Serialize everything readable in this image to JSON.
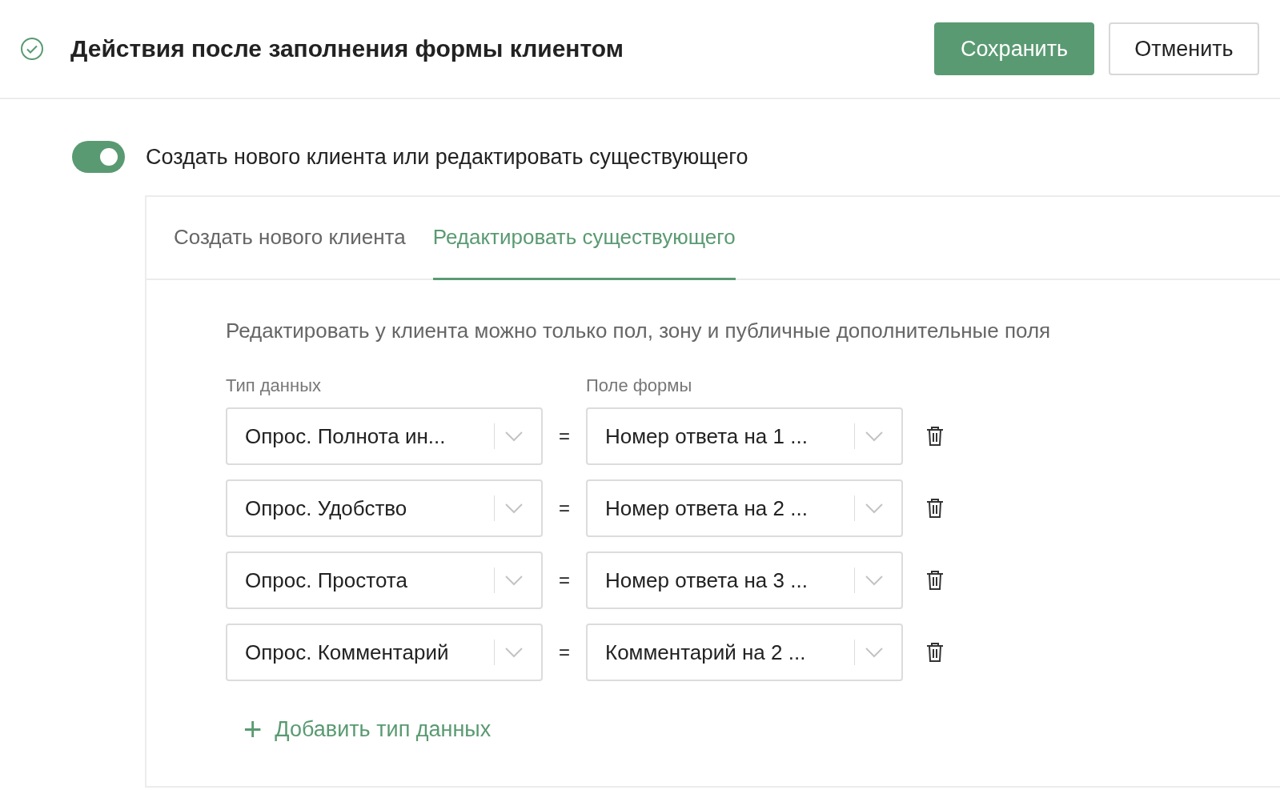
{
  "header": {
    "title": "Действия после заполнения формы клиентом",
    "buttons": [
      {
        "label": "Сохранить",
        "kind": "primary"
      },
      {
        "label": "Отменить",
        "kind": "secondary"
      }
    ]
  },
  "toggle": {
    "label": "Создать нового клиента или редактировать существующего",
    "on": true
  },
  "tabs": [
    {
      "label": "Создать нового клиента",
      "selected": false
    },
    {
      "label": "Редактировать существующего",
      "selected": true
    }
  ],
  "description": "Редактировать у клиента можно только пол, зону и публичные дополнительные поля",
  "columns": [
    "Тип данных",
    "Поле формы"
  ],
  "rows": [
    {
      "data_type": "Опрос. Полнота ин...",
      "operator": "=",
      "form_field": "Номер ответа на 1 ..."
    },
    {
      "data_type": "Опрос. Удобство",
      "operator": "=",
      "form_field": "Номер ответа на 2 ..."
    },
    {
      "data_type": "Опрос. Простота",
      "operator": "=",
      "form_field": "Номер ответа на 3 ..."
    },
    {
      "data_type": "Опрос. Комментарий",
      "operator": "=",
      "form_field": "Комментарий на 2 ..."
    }
  ],
  "add_button": {
    "icon": "+",
    "label": "Добавить тип данных"
  }
}
